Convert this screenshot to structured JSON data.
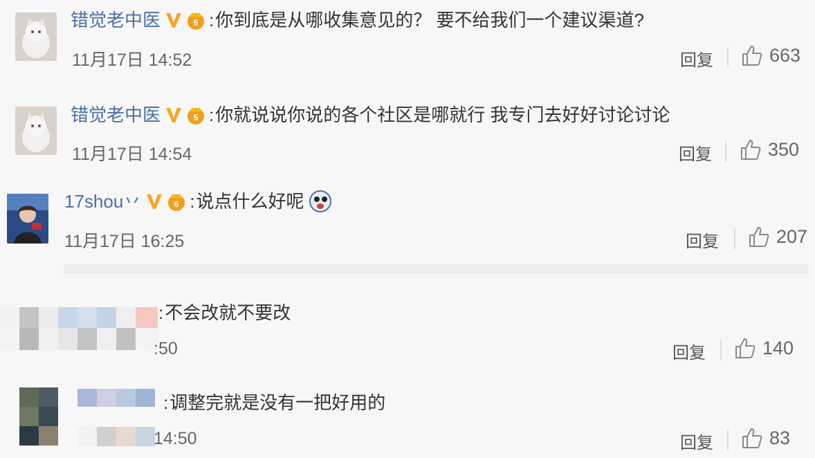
{
  "comments": [
    {
      "username": "错觉老中医",
      "colon": ":",
      "text": "你到底是从哪收集意见的？ 要不给我们一个建议渠道?",
      "time": "11月17日 14:52",
      "reply": "回复",
      "likes": "663"
    },
    {
      "username": "错觉老中医",
      "colon": ":",
      "text": "你就说说你说的各个社区是哪就行 我专门去好好讨论讨论",
      "time": "11月17日 14:54",
      "reply": "回复",
      "likes": "350"
    },
    {
      "username": "17shou丷",
      "colon": ":",
      "text": "说点什么好呢",
      "time": "11月17日 16:25",
      "reply": "回复",
      "likes": "207"
    },
    {
      "username": "",
      "colon": ":",
      "text": "不会改就不要改",
      "time": ":50",
      "reply": "回复",
      "likes": "140"
    },
    {
      "username": "",
      "colon": ":",
      "text": "调整完就是没有一把好用的",
      "time": "14:50",
      "reply": "回复",
      "likes": "83"
    }
  ],
  "colors": {
    "username": "#4a6fa8",
    "v_badge": "#f5a623",
    "crown": "#f0a020",
    "background": "#f7f7f7"
  },
  "icons": {
    "like": "thumbs-up-icon",
    "verified": "v-badge-icon",
    "member": "crown-icon"
  }
}
